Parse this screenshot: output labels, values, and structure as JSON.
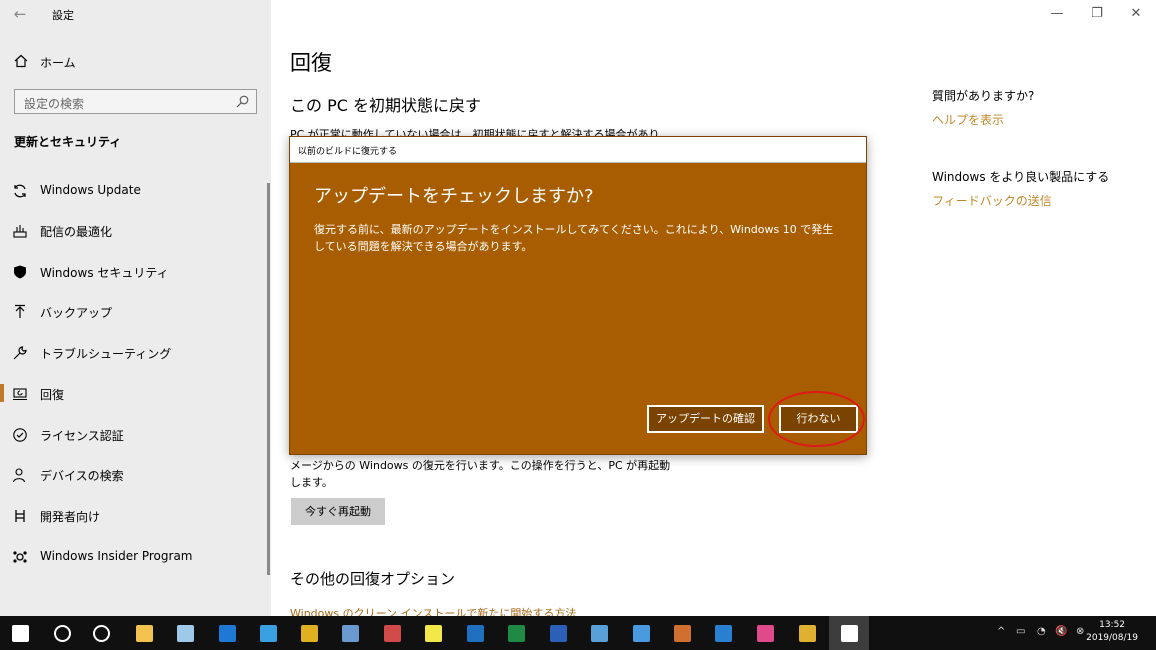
{
  "window": {
    "title": "設定",
    "back_glyph": "←",
    "minimize_glyph": "—",
    "restore_glyph": "❐",
    "close_glyph": "✕"
  },
  "sidebar": {
    "home_label": "ホーム",
    "search_placeholder": "設定の検索",
    "section_title": "更新とセキュリティ",
    "items": [
      {
        "label": "Windows Update",
        "icon": "sync-icon"
      },
      {
        "label": "配信の最適化",
        "icon": "delivery-icon"
      },
      {
        "label": "Windows セキュリティ",
        "icon": "shield-icon"
      },
      {
        "label": "バックアップ",
        "icon": "backup-icon"
      },
      {
        "label": "トラブルシューティング",
        "icon": "wrench-icon"
      },
      {
        "label": "回復",
        "icon": "recovery-icon",
        "active": true
      },
      {
        "label": "ライセンス認証",
        "icon": "check-circle-icon"
      },
      {
        "label": "デバイスの検索",
        "icon": "person-pin-icon"
      },
      {
        "label": "開発者向け",
        "icon": "developer-icon"
      },
      {
        "label": "Windows Insider Program",
        "icon": "insider-icon"
      }
    ]
  },
  "main": {
    "title": "回復",
    "reset_title": "この PC を初期状態に戻す",
    "reset_desc": "PC が正常に動作していない場合は、初期状態に戻すと解決する場合があり",
    "advanced_desc": "メージからの Windows の復元を行います。この操作を行うと、PC が再起動します。",
    "restart_button": "今すぐ再起動",
    "other_options_title": "その他の回復オプション",
    "clean_install_link": "Windows のクリーン インストールで新たに開始する方法"
  },
  "right_panel": {
    "question_title": "質問がありますか?",
    "help_link": "ヘルプを表示",
    "improve_title": "Windows をより良い製品にする",
    "feedback_link": "フィードバックの送信"
  },
  "dialog": {
    "window_title": "以前のビルドに復元する",
    "heading": "アップデートをチェックしますか?",
    "body": "復元する前に、最新のアップデートをインストールしてみてください。これにより、Windows 10 で発生している問題を解決できる場合があります。",
    "check_button": "アップデートの確認",
    "no_button": "行わない"
  },
  "taskbar": {
    "time": "13:52",
    "date": "2019/08/19",
    "tray_glyphs": [
      "^",
      "▭",
      "◔",
      "🔇",
      "⊗"
    ],
    "apps": [
      {
        "name": "start-icon",
        "color": "#ffffff"
      },
      {
        "name": "search-icon",
        "color": "#ffffff"
      },
      {
        "name": "task-view-icon",
        "color": "#ffffff"
      },
      {
        "name": "file-explorer-icon",
        "color": "#f2c14e"
      },
      {
        "name": "notepad-icon",
        "color": "#9ec9e8"
      },
      {
        "name": "edge-icon",
        "color": "#1e78d4"
      },
      {
        "name": "ie-icon",
        "color": "#3aa0e0"
      },
      {
        "name": "chrome-icon",
        "color": "#e0b020"
      },
      {
        "name": "network-icon",
        "color": "#6a9ad0"
      },
      {
        "name": "paint-icon",
        "color": "#d04a4a"
      },
      {
        "name": "sticky-notes-icon",
        "color": "#f2e84a"
      },
      {
        "name": "app-blue-icon",
        "color": "#1f6fbf"
      },
      {
        "name": "excel-icon",
        "color": "#1f8a44"
      },
      {
        "name": "word-icon",
        "color": "#2b5fb8"
      },
      {
        "name": "paint3d-icon",
        "color": "#5aa0d8"
      },
      {
        "name": "media-icon",
        "color": "#4a9ae0"
      },
      {
        "name": "toolbox-icon",
        "color": "#d07030"
      },
      {
        "name": "remote-desktop-icon",
        "color": "#2a80d0"
      },
      {
        "name": "whiteboard-icon",
        "color": "#e04a8a"
      },
      {
        "name": "slack-icon",
        "color": "#e0b030"
      },
      {
        "name": "settings-icon",
        "color": "#ffffff",
        "active": true
      }
    ]
  }
}
